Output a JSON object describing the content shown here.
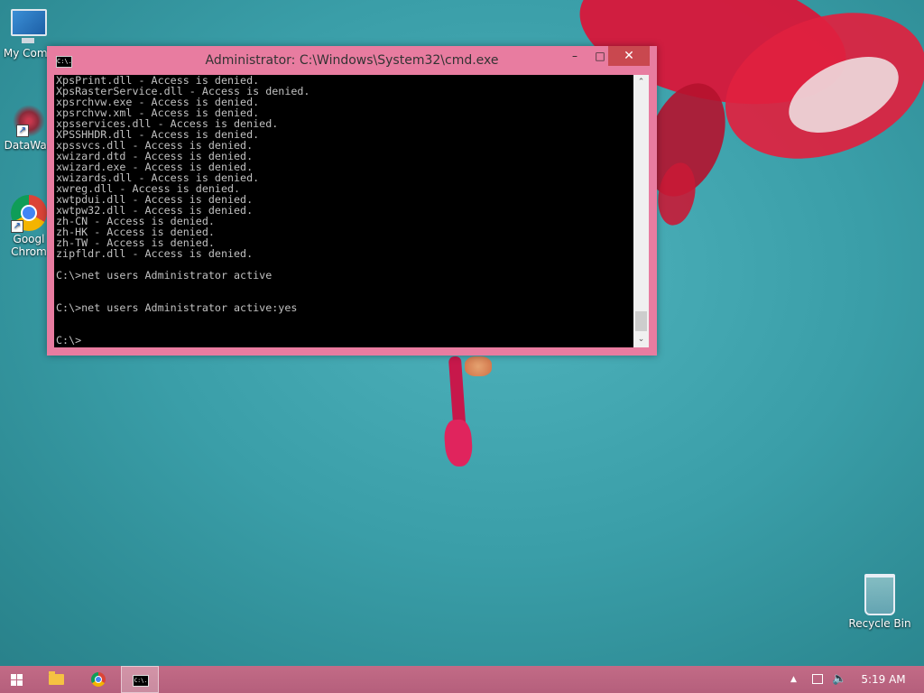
{
  "desktop": {
    "icons": [
      {
        "label": "My Comp",
        "icon": "computer-icon"
      },
      {
        "label": "DataWag",
        "icon": "datawag-icon"
      },
      {
        "label": "Googl\nChrom",
        "icon": "chrome-icon"
      },
      {
        "label": "Recycle Bin",
        "icon": "recycle-bin-icon"
      }
    ]
  },
  "window": {
    "title": "Administrator:  C:\\Windows\\System32\\cmd.exe",
    "icon_text": "C:\\.",
    "buttons": {
      "minimize": "–",
      "maximize": "□",
      "close": "✕"
    },
    "console_lines": [
      "XpsPrint.dll - Access is denied.",
      "XpsRasterService.dll - Access is denied.",
      "xpsrchvw.exe - Access is denied.",
      "xpsrchvw.xml - Access is denied.",
      "xpsservices.dll - Access is denied.",
      "XPSSHHDR.dll - Access is denied.",
      "xpssvcs.dll - Access is denied.",
      "xwizard.dtd - Access is denied.",
      "xwizard.exe - Access is denied.",
      "xwizards.dll - Access is denied.",
      "xwreg.dll - Access is denied.",
      "xwtpdui.dll - Access is denied.",
      "xwtpw32.dll - Access is denied.",
      "zh-CN - Access is denied.",
      "zh-HK - Access is denied.",
      "zh-TW - Access is denied.",
      "zipfldr.dll - Access is denied.",
      "",
      "C:\\>net users Administrator active",
      "",
      "",
      "C:\\>net users Administrator active:yes",
      "",
      "",
      "C:\\>"
    ],
    "colors": {
      "frame": "#e87ca0",
      "console_bg": "#000000",
      "console_fg": "#c0c0c0",
      "close": "#c9484f"
    }
  },
  "taskbar": {
    "items": [
      {
        "name": "start",
        "icon": "windows-logo-icon"
      },
      {
        "name": "file-explorer",
        "icon": "folder-icon"
      },
      {
        "name": "chrome",
        "icon": "chrome-icon"
      },
      {
        "name": "cmd",
        "icon": "command-prompt-icon",
        "icon_text": "C:\\."
      }
    ],
    "tray": {
      "chevron": "▲",
      "volume": "🔈",
      "time": "5:19 AM"
    },
    "color": "#bb6580"
  }
}
